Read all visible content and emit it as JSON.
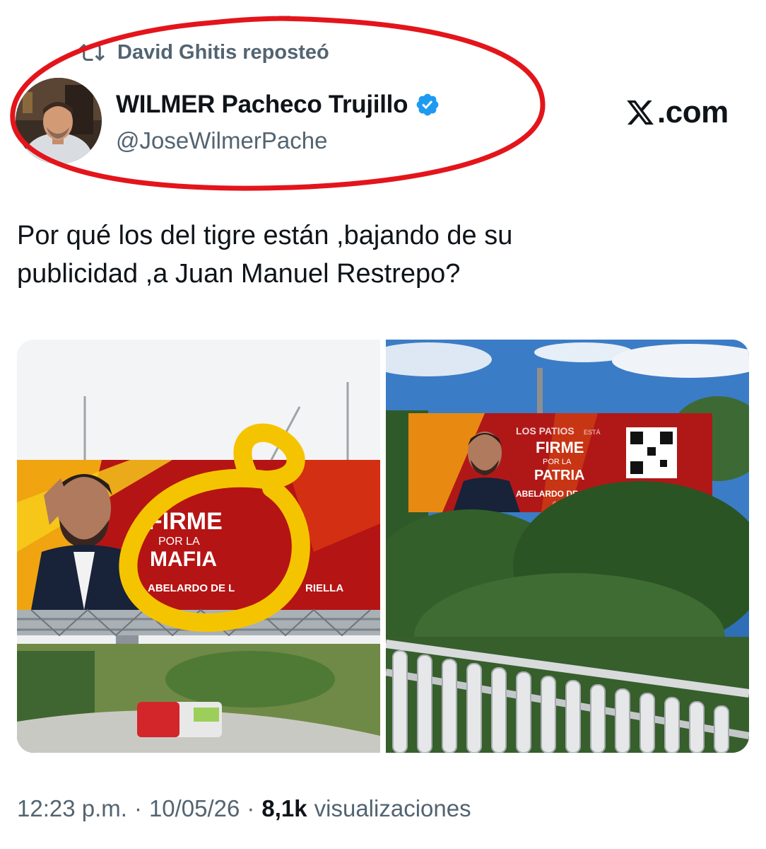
{
  "repost": {
    "text": "David Ghitis reposteó",
    "icon": "repost-icon"
  },
  "author": {
    "name": "WILMER Pacheco Trujillo",
    "handle": "@JoseWilmerPache",
    "verified": true,
    "verified_color": "#1d9bf0"
  },
  "brand": {
    "logo_text": ".com",
    "icon": "x-logo-icon"
  },
  "tweet": {
    "text_line1": "Por qué los del tigre están ,bajando de su",
    "text_line2": "publicidad ,a Juan Manuel Restrepo?"
  },
  "media": {
    "left": {
      "billboard_line1": "FIRME",
      "billboard_line2": "POR LA",
      "billboard_line3": "MAFIA",
      "billboard_line4": "ABELARDO DE L",
      "billboard_line4b": "RIELLA",
      "annotation_color": "#f5c400"
    },
    "right": {
      "billboard_line0": "LOS PATIOS",
      "billboard_line0b": "ESTÁ",
      "billboard_line1": "FIRME",
      "billboard_line2": "POR LA",
      "billboard_line3": "PATRIA",
      "billboard_line4": "ABELARDO DE LA ESPRI",
      "billboard_line5": "defensoresdelapa"
    }
  },
  "meta": {
    "time": "12:23 p.m.",
    "separator": "·",
    "date": "10/05/26",
    "views_count": "8,1k",
    "views_label": "visualizaciones"
  },
  "colors": {
    "annotation_red": "#e3151b",
    "text_secondary": "#536471"
  }
}
